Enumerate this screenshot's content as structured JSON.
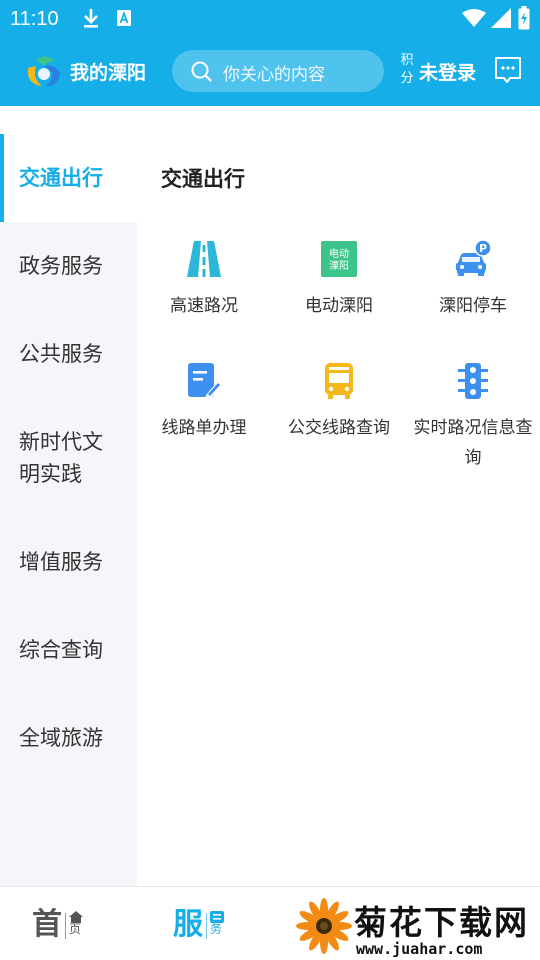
{
  "status_bar": {
    "time": "11:10",
    "icons": [
      "download-icon",
      "notification-a-icon",
      "wifi-icon",
      "signal-icon",
      "battery-charging-icon"
    ]
  },
  "header": {
    "city_title": "我的溧阳",
    "search_placeholder": "你关心的内容",
    "points_label_top": "积",
    "points_label_bottom": "分",
    "login_label": "未登录",
    "colors": {
      "primary": "#15aee8"
    }
  },
  "sidebar": {
    "items": [
      {
        "label": "交通出行",
        "active": true
      },
      {
        "label": "政务服务"
      },
      {
        "label": "公共服务"
      },
      {
        "label": "新时代文",
        "label2": "明实践"
      },
      {
        "label": "增值服务"
      },
      {
        "label": "综合查询"
      },
      {
        "label": "全域旅游"
      }
    ]
  },
  "main": {
    "section_title": "交通出行",
    "tiles": [
      {
        "label": "高速路况",
        "icon": "highway-icon",
        "color": "#2bb8d8"
      },
      {
        "label": "电动溧阳",
        "icon": "electric-liyang-icon",
        "color": "#3cc48a",
        "icon_text1": "电动",
        "icon_text2": "溧阳"
      },
      {
        "label": "溧阳停车",
        "icon": "parking-car-icon",
        "color": "#3d8ff0"
      },
      {
        "label": "线路单办理",
        "icon": "document-edit-icon",
        "color": "#3d8ff0"
      },
      {
        "label": "公交线路查询",
        "icon": "bus-icon",
        "color": "#f5b81a"
      },
      {
        "label": "实时路况信息查",
        "label2": "询",
        "icon": "traffic-light-icon",
        "color": "#3d8ff0"
      }
    ]
  },
  "bottom_nav": {
    "tabs": [
      {
        "big": "首",
        "small": "页",
        "icon": "home-icon",
        "active": false
      },
      {
        "big": "服",
        "small": "务",
        "icon": "service-icon",
        "active": true
      }
    ]
  },
  "watermark": {
    "title": "菊花下载网",
    "url": "www.juahar.com"
  }
}
